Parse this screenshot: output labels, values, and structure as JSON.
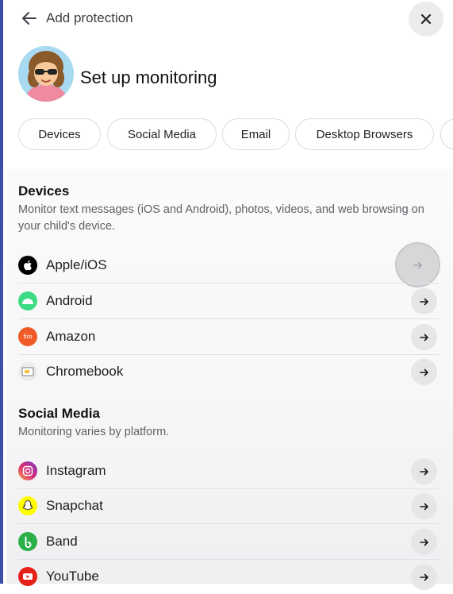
{
  "header": {
    "back_label": "Add protection",
    "title": "Set up monitoring"
  },
  "tabs": [
    "Devices",
    "Social Media",
    "Email",
    "Desktop Browsers"
  ],
  "devices": {
    "title": "Devices",
    "description": "Monitor text messages (iOS and Android), photos, videos, and web browsing on your child's device.",
    "items": [
      {
        "label": "Apple/iOS",
        "icon": "apple-icon"
      },
      {
        "label": "Android",
        "icon": "android-icon"
      },
      {
        "label": "Amazon",
        "icon": "amazon-fire-icon"
      },
      {
        "label": "Chromebook",
        "icon": "chromebook-icon"
      }
    ]
  },
  "social": {
    "title": "Social Media",
    "description": "Monitoring varies by platform.",
    "items": [
      {
        "label": "Instagram",
        "icon": "instagram-icon"
      },
      {
        "label": "Snapchat",
        "icon": "snapchat-icon"
      },
      {
        "label": "Band",
        "icon": "band-icon"
      },
      {
        "label": "YouTube",
        "icon": "youtube-icon"
      }
    ]
  },
  "colors": {
    "accent_border": "#3b4fa8",
    "android": "#3ddc84",
    "amazon": "#f05a28",
    "snapchat": "#fffc00",
    "band": "#2bb04a",
    "youtube": "#e62117"
  }
}
